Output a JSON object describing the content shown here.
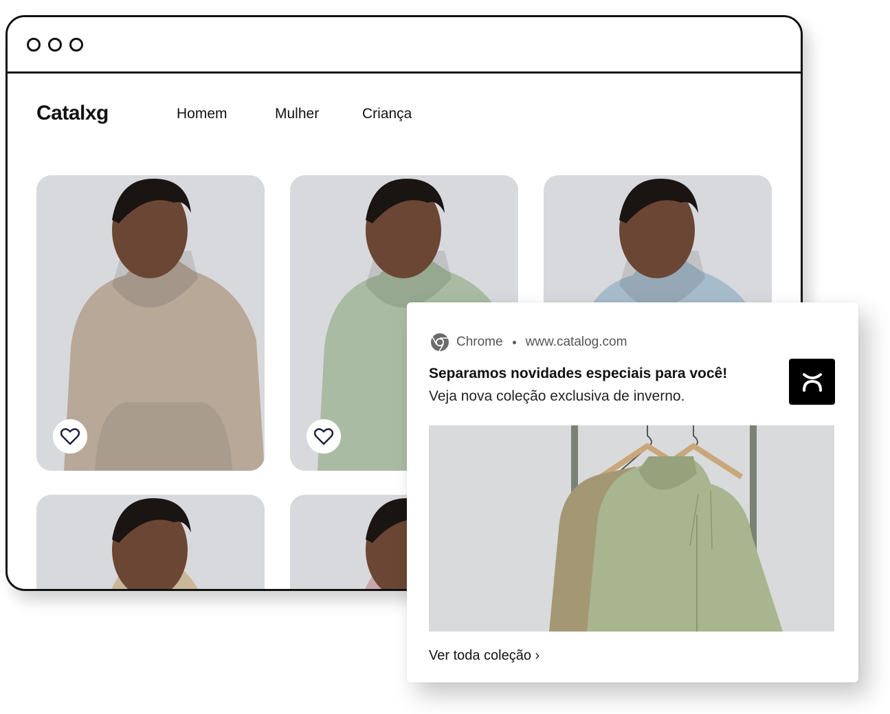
{
  "browser": {
    "nav": {
      "logo": "Catalxg",
      "items": [
        "Homem",
        "Mulher",
        "Criança"
      ]
    },
    "products": [
      {
        "color": "beige",
        "hoodie_color": "#b7a898"
      },
      {
        "color": "sage",
        "hoodie_color": "#a9bba2"
      },
      {
        "color": "blue",
        "hoodie_color": "#a7bccb"
      },
      {
        "color": "sand",
        "hoodie_color": "#c8b898"
      },
      {
        "color": "pink",
        "hoodie_color": "#c7a7ab"
      }
    ]
  },
  "notification": {
    "app": "Chrome",
    "url": "www.catalog.com",
    "title": "Separamos novidades especiais para você!",
    "body": "Veja nova coleção exclusiva de inverno.",
    "link": "Ver toda coleção ›"
  },
  "colors": {
    "card_bg": "#d8d9dc",
    "skin": "#6b4634",
    "hair": "#1a1412",
    "ink": "#111111"
  }
}
